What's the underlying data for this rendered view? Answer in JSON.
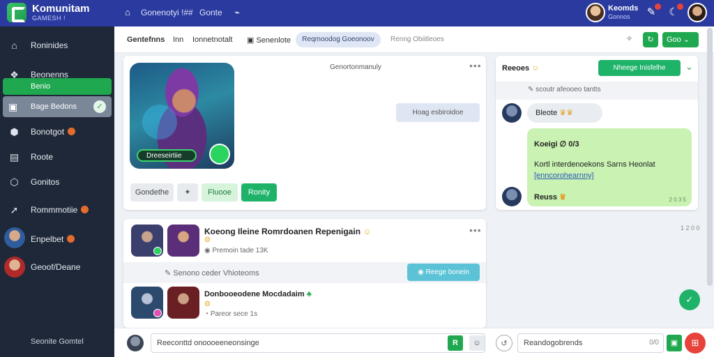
{
  "topbar": {
    "brand": "Komunitam",
    "brand_sub": "GAMESH !",
    "nav_item_1": "Gonenotyi !##",
    "nav_item_2": "Gonte",
    "user_name": "Keomds",
    "user_role": "Gonnos"
  },
  "sidebar": {
    "items": [
      {
        "label": "Roninides"
      },
      {
        "label": "Beonenns"
      },
      {
        "label": "Benio"
      },
      {
        "label": "Bage Bedons"
      },
      {
        "label": "Bonotgot"
      },
      {
        "label": "Roote"
      },
      {
        "label": "Gonitos"
      },
      {
        "label": "Rommmotiie"
      },
      {
        "label": "Enpelbet"
      },
      {
        "label": "Geoof/Deane"
      }
    ],
    "footer": "Seonite Gomtel"
  },
  "subheader": {
    "tab_1": "Gentefnns",
    "tab_2": "Inn",
    "tab_3": "Ionnetnotalt",
    "tab_4": "Senenlote",
    "pill": "Reqmoodog Goeonoov",
    "tab_5": "Renng Obiitleoes",
    "btn": "Goo"
  },
  "feature": {
    "header": "Genortonmanuly",
    "art_label": "Dreeseirtiie",
    "tag": "Hoag esbiroidoe",
    "btn_1": "Gondethe",
    "btn_2": "Fluooe",
    "btn_3": "Ronity"
  },
  "feed": {
    "title": "Koeong Ileine Romrdoanen Repenigain",
    "meta": "Premoin tade 13K",
    "row_label": "Senono ceder Vhioteoms",
    "action": "Reege bonein",
    "title_2": "Donbooeodene Mocdadaim",
    "meta_2": "Pareor sece 1s"
  },
  "chat": {
    "title": "Reeoes",
    "header_btn": "Nheege Inisfelhe",
    "date_label": "scoutr afeooeo tantts",
    "msg_1": "Bleote",
    "msg_2_line1": "Koeigi ∅ 0/3",
    "msg_2_line2": "Kortl interdenoekons Sarns Heonlat",
    "msg_2_link": "[enncorohearnny]",
    "msg_2_user": "Reuss",
    "msg_2_time": "2 0 3 5",
    "side_time": "1 2 0 0"
  },
  "composer": {
    "left_placeholder": "Reeconttd onoooeeneonsinge",
    "right_placeholder": "Reandogobrends",
    "right_count": "0/0"
  },
  "colors": {
    "topbar": "#2a3a9e",
    "sidebar": "#1f2838",
    "accent_green": "#1fa84f",
    "badge_orange": "#e46c2c",
    "danger_red": "#e8433b"
  }
}
